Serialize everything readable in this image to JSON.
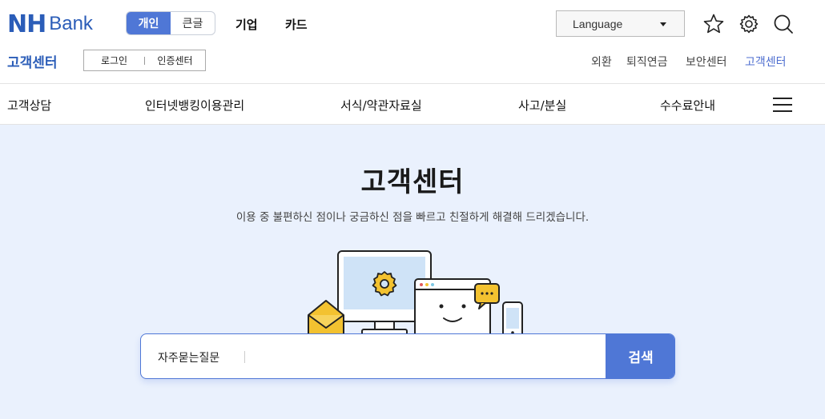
{
  "logo": {
    "nh": "NH",
    "bank": "Bank"
  },
  "segment": {
    "personal": "개인",
    "large_text": "큰글"
  },
  "topnav": {
    "corporate": "기업",
    "card": "카드"
  },
  "language": {
    "label": "Language"
  },
  "icons": {
    "favorite": "star-icon",
    "settings": "gear-icon",
    "search": "search-icon",
    "menu": "hamburger-icon"
  },
  "subheader": {
    "title": "고객센터",
    "login": "로그인",
    "cert_center": "인증센터",
    "links": [
      "외환",
      "퇴직연금",
      "보안센터",
      "고객센터"
    ]
  },
  "mainnav": [
    "고객상담",
    "인터넷뱅킹이용관리",
    "서식/약관자료실",
    "사고/분실",
    "수수료안내"
  ],
  "hero": {
    "title": "고객센터",
    "subtitle": "이용 중 불편하신 점이나 궁금하신 점을 빠르고 친절하게 해결해 드리겠습니다."
  },
  "search": {
    "category": "자주묻는질문",
    "placeholder": "",
    "button": "검색"
  },
  "colors": {
    "brand": "#2b5db8",
    "accent": "#4f77d6",
    "hero_bg": "#eaf1fd"
  }
}
